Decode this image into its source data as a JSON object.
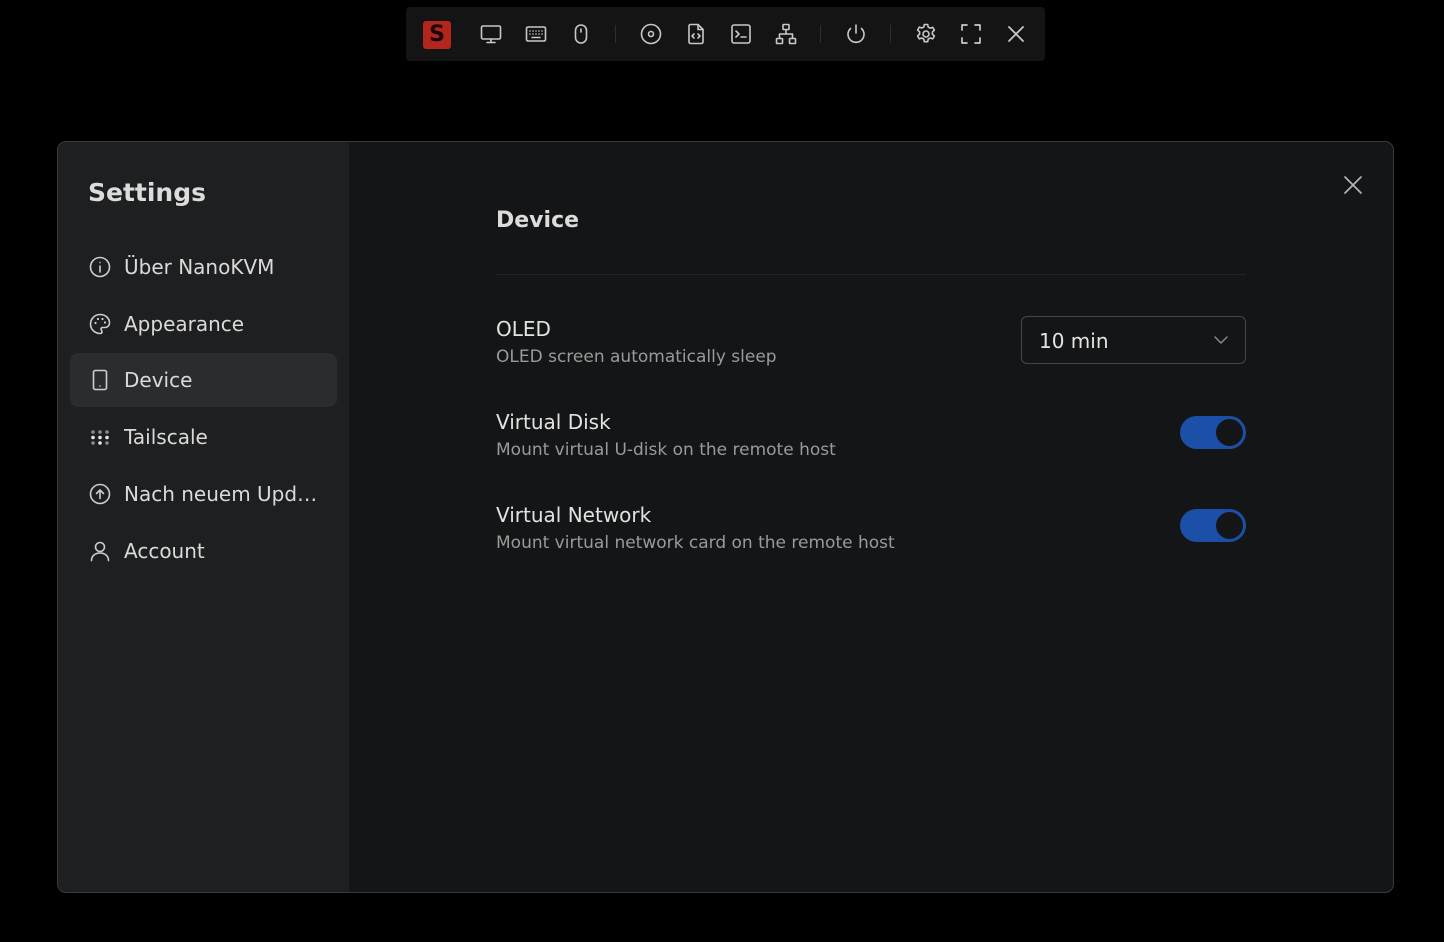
{
  "toolbar": {
    "logo_letter": "S",
    "buttons": [
      {
        "name": "screen",
        "icon": "monitor-icon"
      },
      {
        "name": "keyboard",
        "icon": "keyboard-icon"
      },
      {
        "name": "mouse",
        "icon": "mouse-icon"
      },
      {
        "name": "virtual-media",
        "icon": "disc-icon"
      },
      {
        "name": "script",
        "icon": "file-code-icon"
      },
      {
        "name": "terminal",
        "icon": "terminal-icon"
      },
      {
        "name": "network",
        "icon": "network-icon"
      },
      {
        "name": "power",
        "icon": "power-icon"
      },
      {
        "name": "settings",
        "icon": "gear-icon"
      },
      {
        "name": "fullscreen",
        "icon": "fullscreen-icon"
      },
      {
        "name": "close",
        "icon": "close-icon"
      }
    ]
  },
  "sidebar": {
    "title": "Settings",
    "items": [
      {
        "label": "Über NanoKVM",
        "icon": "info-icon",
        "active": false
      },
      {
        "label": "Appearance",
        "icon": "palette-icon",
        "active": false
      },
      {
        "label": "Device",
        "icon": "tablet-icon",
        "active": true
      },
      {
        "label": "Tailscale",
        "icon": "tailscale-icon",
        "active": false
      },
      {
        "label": "Nach neuem Upda...",
        "icon": "arrow-up-circle-icon",
        "active": false
      },
      {
        "label": "Account",
        "icon": "user-icon",
        "active": false
      }
    ]
  },
  "content": {
    "title": "Device",
    "oled": {
      "title": "OLED",
      "description": "OLED screen automatically sleep",
      "value": "10 min"
    },
    "virtual_disk": {
      "title": "Virtual Disk",
      "description": "Mount virtual U-disk on the remote host",
      "enabled": true
    },
    "virtual_network": {
      "title": "Virtual Network",
      "description": "Mount virtual network card on the remote host",
      "enabled": true
    }
  },
  "colors": {
    "background": "#000000",
    "dialog": "#141516",
    "sidebar": "#1e1f20",
    "active_item": "#2b2c2e",
    "accent": "#1b4fa8",
    "logo": "#b3261e"
  }
}
